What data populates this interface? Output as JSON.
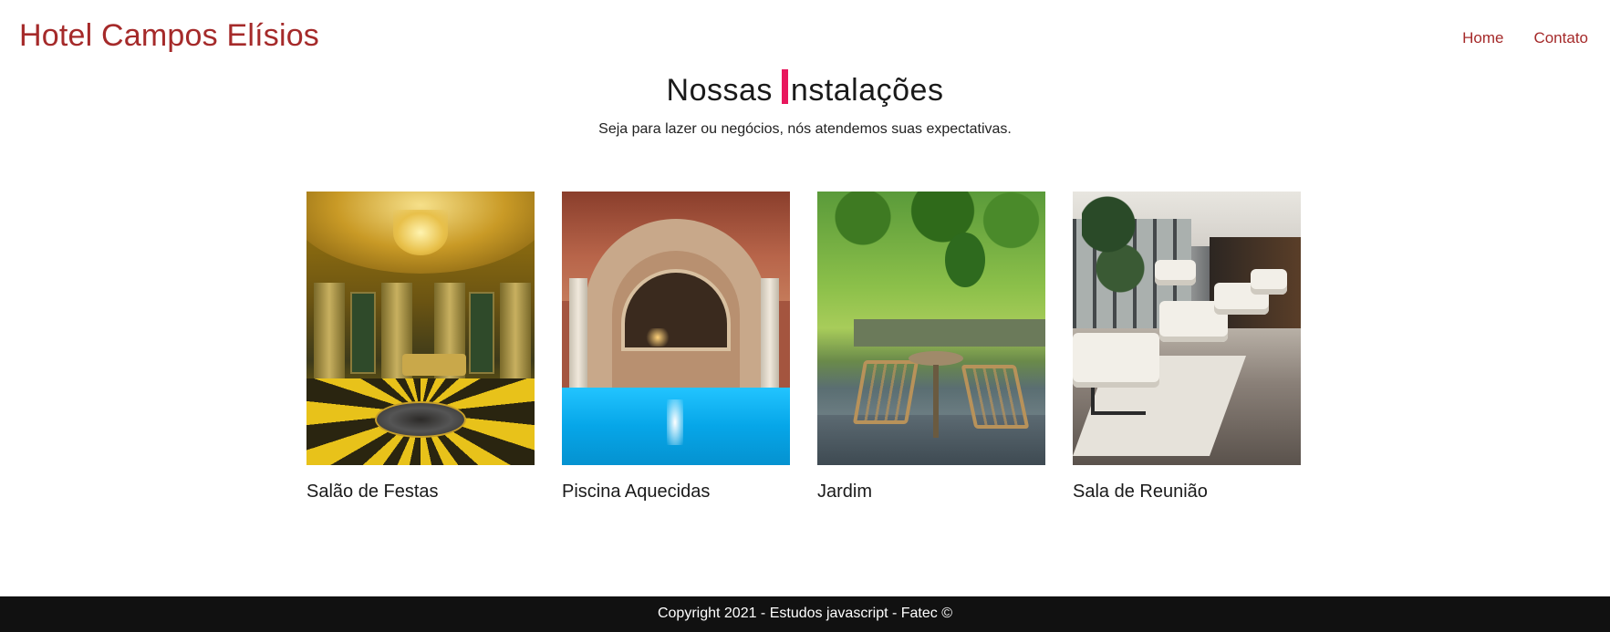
{
  "header": {
    "brand": "Hotel Campos Elísios",
    "nav": [
      {
        "label": "Home"
      },
      {
        "label": "Contato"
      }
    ]
  },
  "section": {
    "title_prefix": "Nossas",
    "title_suffix": "nstalações",
    "subtitle": "Seja para lazer ou negócios, nós atendemos suas expectativas.",
    "accent_color": "#e8175d"
  },
  "facilities": [
    {
      "label": "Salão de Festas",
      "image": "ballroom-photo"
    },
    {
      "label": "Piscina Aquecidas",
      "image": "indoor-pool-photo"
    },
    {
      "label": "Jardim",
      "image": "garden-photo"
    },
    {
      "label": "Sala de Reunião",
      "image": "lounge-photo"
    }
  ],
  "footer": {
    "text": "Copyright 2021 - Estudos javascript - Fatec ©"
  },
  "colors": {
    "brand": "#a52a2a",
    "footer_bg": "#111111"
  }
}
